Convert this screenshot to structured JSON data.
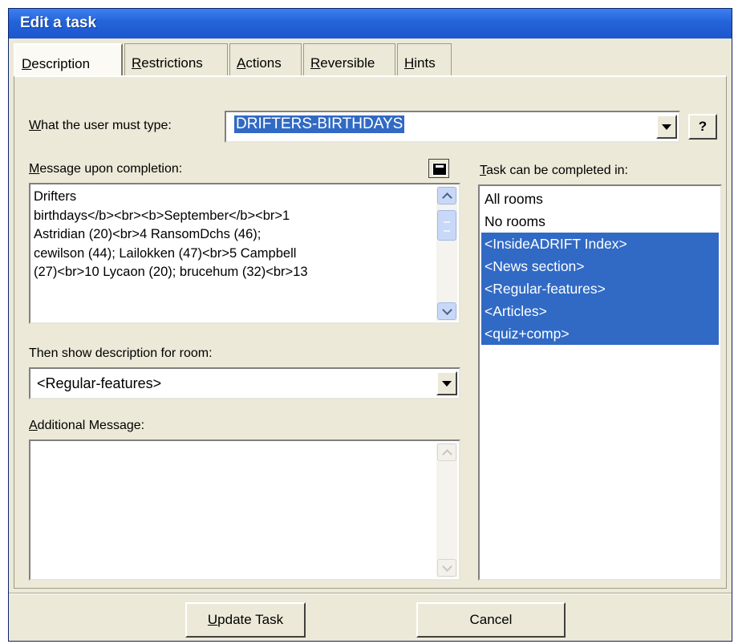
{
  "window": {
    "title": "Edit a task"
  },
  "tabs": [
    {
      "prefix": "",
      "accel": "D",
      "rest": "escription"
    },
    {
      "prefix": "",
      "accel": "R",
      "rest": "estrictions"
    },
    {
      "prefix": "",
      "accel": "A",
      "rest": "ctions"
    },
    {
      "prefix": "",
      "accel": "R",
      "rest": "eversible"
    },
    {
      "prefix": "",
      "accel": "H",
      "rest": "ints"
    }
  ],
  "command": {
    "label_accel": "W",
    "label_rest": "hat the user must type:",
    "value": "DRIFTERS-BIRTHDAYS",
    "help_label": "?"
  },
  "message": {
    "label_accel": "M",
    "label_rest": "essage upon completion:",
    "lines": [
      "Drifters",
      "birthdays</b><br><b>September</b><br>1",
      "Astridian (20)<br>4 RansomDchs (46);",
      "cewilson (44); Lailokken (47)<br>5 Campbell",
      "(27)<br>10 Lycaon (20); brucehum (32)<br>13"
    ]
  },
  "room_desc": {
    "label": "Then show description for room:",
    "value": "<Regular-features>"
  },
  "additional": {
    "label_accel": "A",
    "label_rest": "dditional Message:",
    "value": ""
  },
  "rooms": {
    "label_accel": "T",
    "label_rest": "ask can be completed in:",
    "items": [
      {
        "label": "All rooms",
        "selected": false
      },
      {
        "label": "No rooms",
        "selected": false
      },
      {
        "label": "<InsideADRIFT Index>",
        "selected": true
      },
      {
        "label": "<News section>",
        "selected": true
      },
      {
        "label": "<Regular-features>",
        "selected": true
      },
      {
        "label": "<Articles>",
        "selected": true
      },
      {
        "label": "<quiz+comp>",
        "selected": true
      }
    ]
  },
  "buttons": {
    "update_accel": "U",
    "update_rest": "pdate Task",
    "cancel": "Cancel"
  },
  "colors": {
    "titlebar": "#2363d8",
    "selection": "#316ac5",
    "face": "#ece9d8"
  }
}
